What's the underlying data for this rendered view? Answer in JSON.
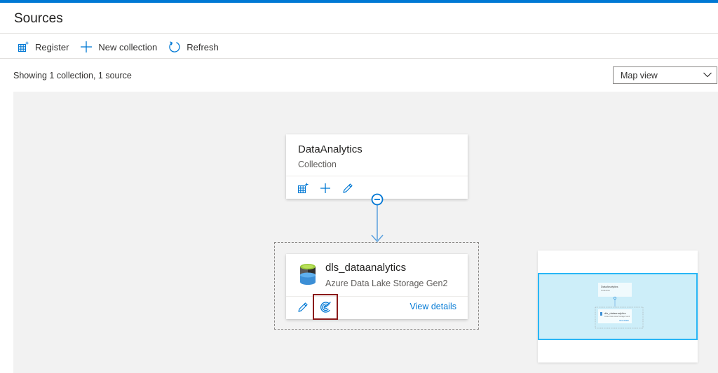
{
  "page": {
    "title": "Sources"
  },
  "toolbar": {
    "register_label": "Register",
    "new_collection_label": "New collection",
    "refresh_label": "Refresh"
  },
  "summary": {
    "text": "Showing 1 collection, 1 source"
  },
  "view_select": {
    "value": "Map view"
  },
  "collection": {
    "name": "DataAnalytics",
    "type": "Collection"
  },
  "source": {
    "name": "dls_dataanalytics",
    "type": "Azure Data Lake Storage Gen2",
    "view_details": "View details"
  },
  "minimap": {
    "collection_name": "DataAnalytics",
    "collection_type": "Collection",
    "source_name": "dls_dataanalytics",
    "source_type": "Azure Data Lake Storage Gen2",
    "view_details": "View details"
  },
  "colors": {
    "accent": "#0078d4",
    "canvas_bg": "#f2f2f2",
    "highlight_border": "#8b1a1a",
    "minimap_viewport": "#cdeef9"
  },
  "icons": {
    "register": "register-grid-icon",
    "new_collection": "plus-icon",
    "refresh": "refresh-icon",
    "edit": "pencil-icon",
    "scan": "scan-icon",
    "dropdown": "chevron-down-icon",
    "collapse": "collapse-minus-icon",
    "datasource": "data-lake-storage-icon"
  }
}
